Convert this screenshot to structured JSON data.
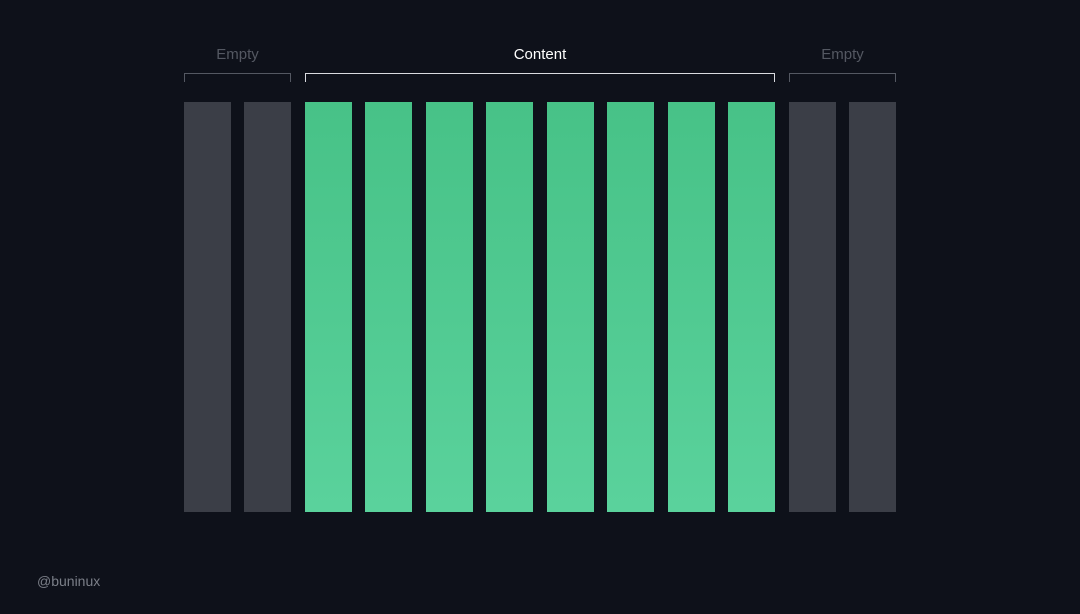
{
  "labels": {
    "left": "Empty",
    "center": "Content",
    "right": "Empty"
  },
  "columns": {
    "left_empty_count": 2,
    "content_count": 8,
    "right_empty_count": 2
  },
  "colors": {
    "background": "#0e111a",
    "empty_column": "#3b3e47",
    "content_column_top": "#47c287",
    "content_column_bottom": "#5ad29c",
    "empty_label": "#545862",
    "content_label": "#ffffff"
  },
  "credit": "@buninux"
}
